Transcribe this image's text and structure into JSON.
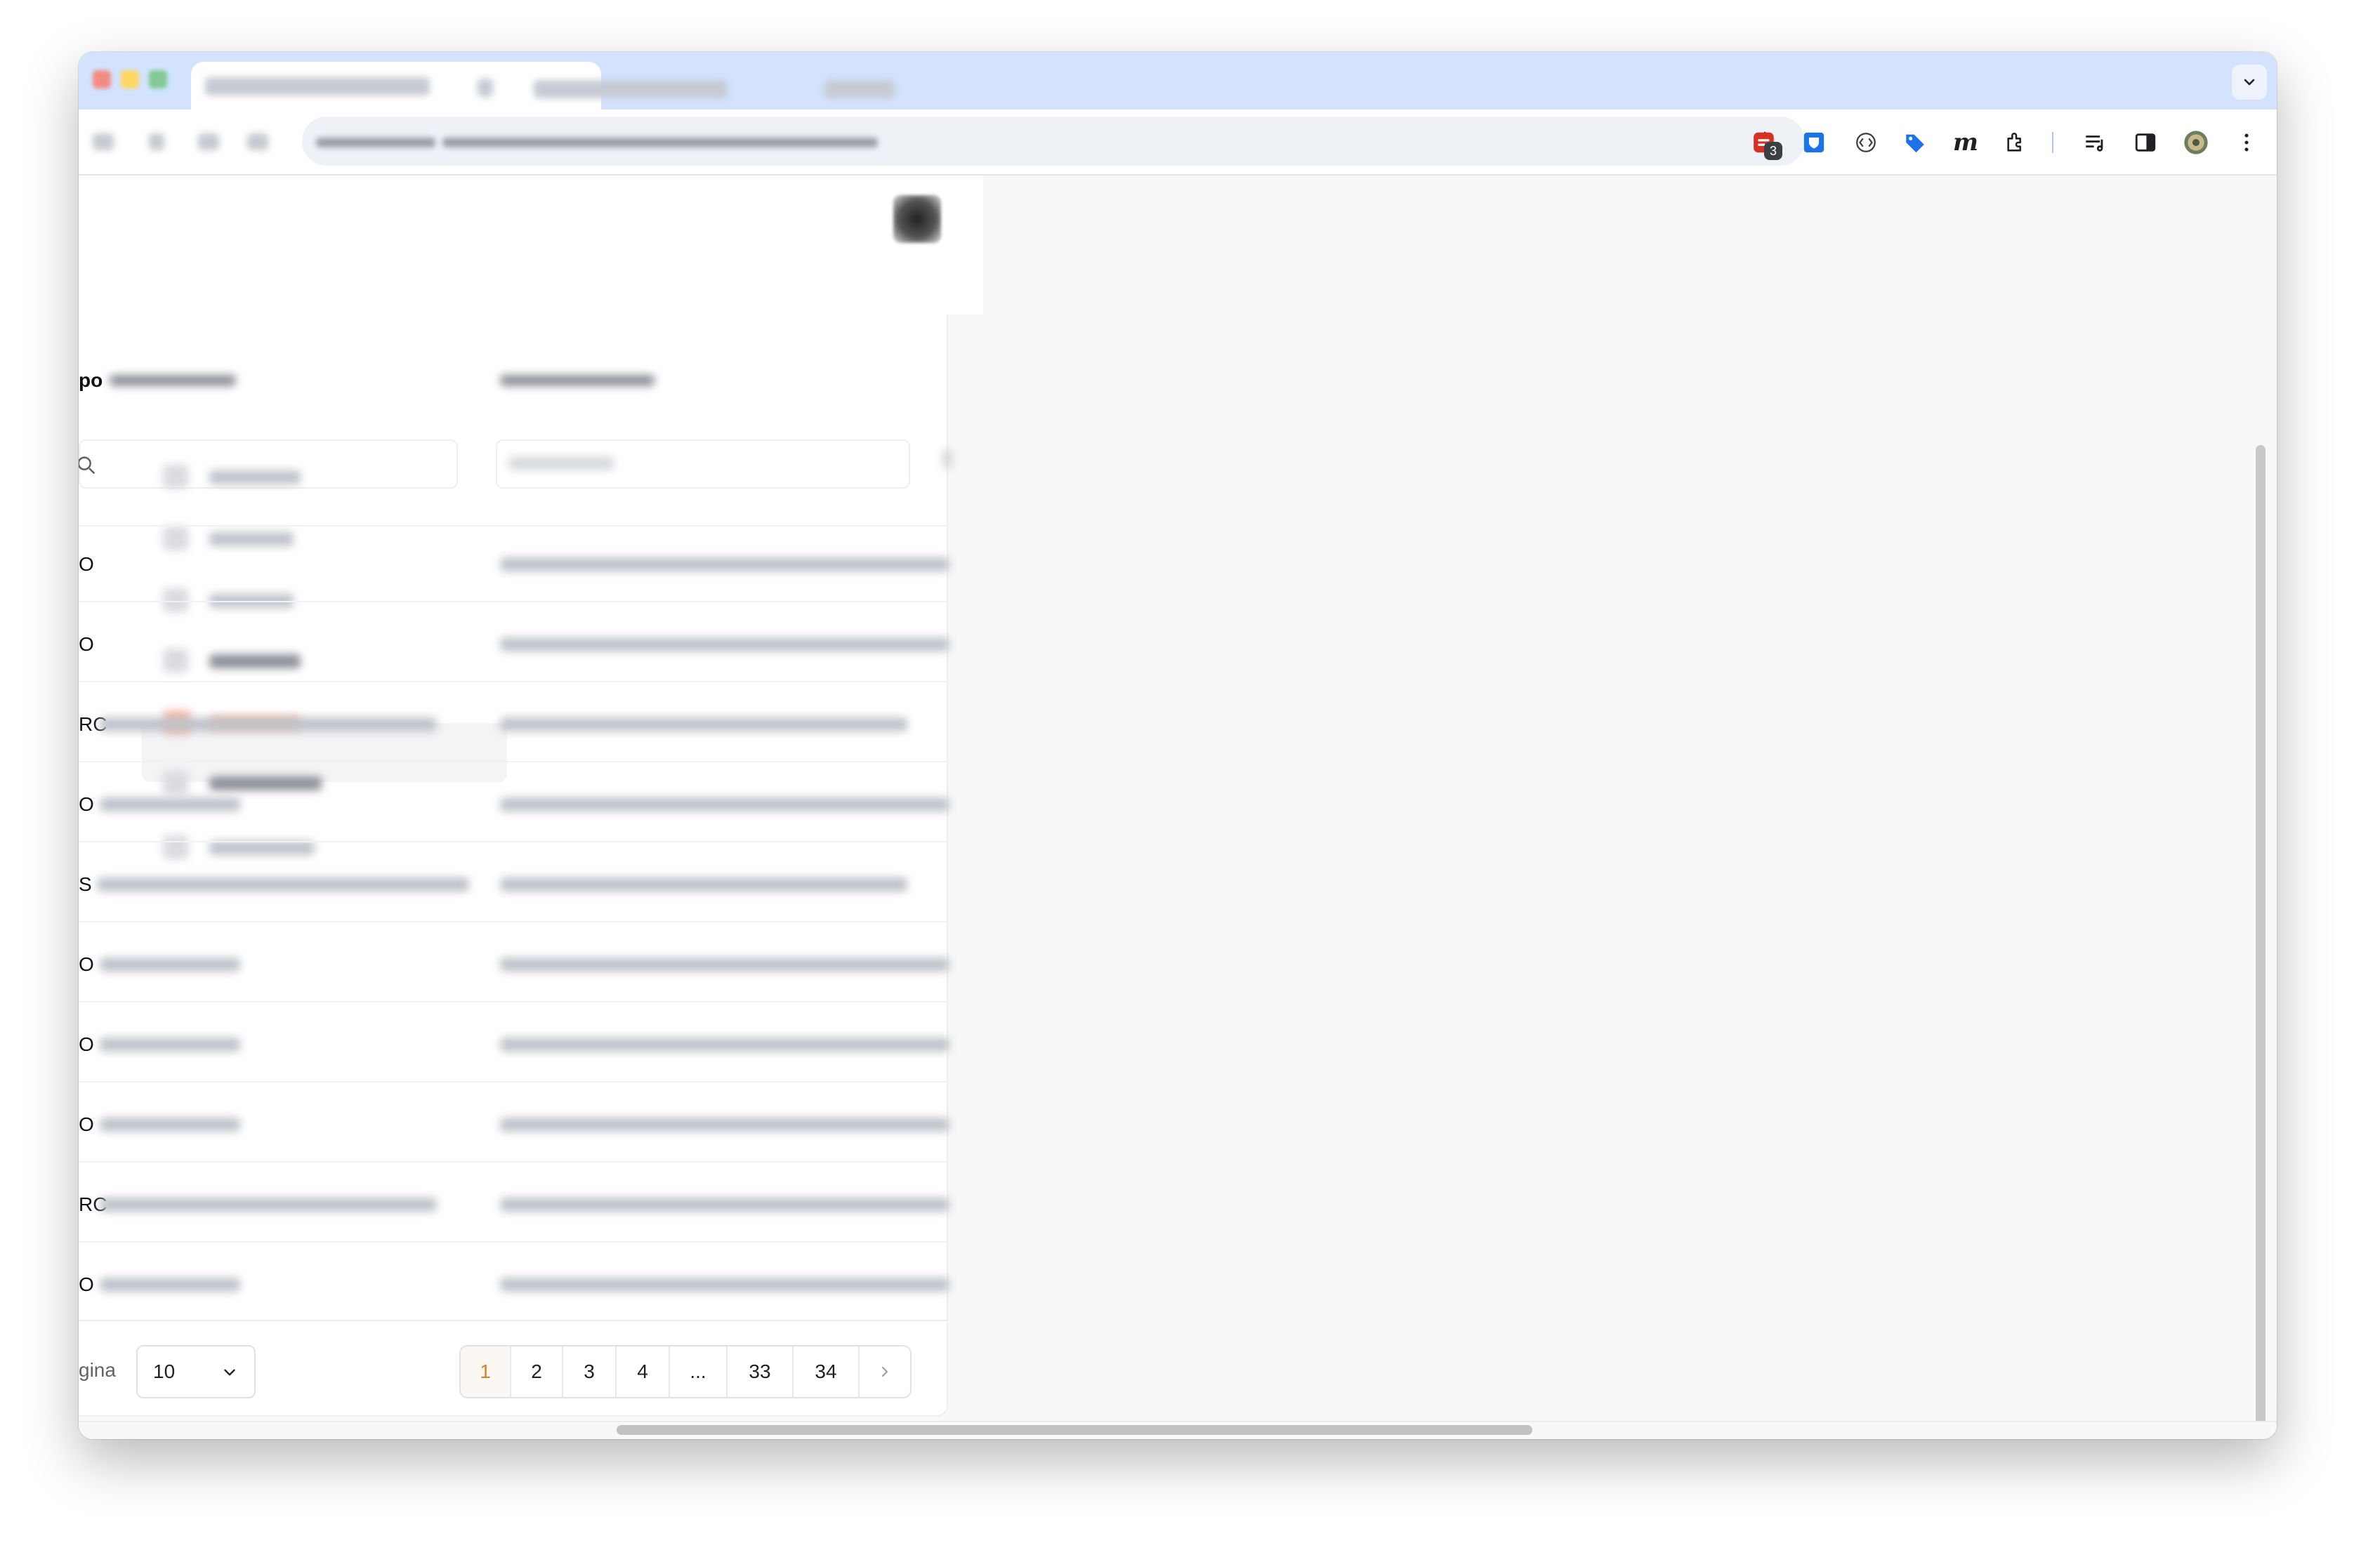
{
  "browser": {
    "extension_badge_count": "3",
    "extension_icons": [
      "todo-extension-icon",
      "bitwarden-icon",
      "code-bracket-icon",
      "tag-icon",
      "m-letter-icon",
      "puzzle-extensions-icon"
    ],
    "m_icon_label": "m",
    "toolbar_icons": [
      "reading-list-icon",
      "side-panel-icon",
      "profile-avatar",
      "more-menu-icon"
    ]
  },
  "table": {
    "row_prefixes": [
      "O",
      "O",
      "RC",
      "O",
      "S",
      "O",
      "O",
      "O",
      "RC",
      "O"
    ],
    "header_prefix": "po"
  },
  "pagination": {
    "per_page_label": "gina",
    "per_page_value": "10",
    "pages": [
      "1",
      "2",
      "3",
      "4",
      "...",
      "33",
      "34"
    ],
    "active_page": "1"
  },
  "colors": {
    "tabstrip": "#d3e3fd",
    "active_page": "#d9822b",
    "menu_highlight": "#f3b9a5"
  }
}
